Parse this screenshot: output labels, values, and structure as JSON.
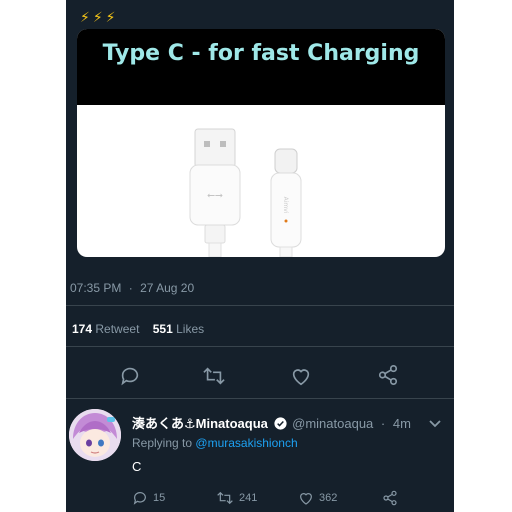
{
  "top_emojis": "⚡⚡⚡",
  "media": {
    "title": "Type C - for fast Charging",
    "cable_brand_text": "Aimvi"
  },
  "tweet": {
    "time": "07:35 PM",
    "separator": "·",
    "date": "27 Aug 20",
    "retweet_count": "174",
    "retweet_label": "Retweet",
    "likes_count": "551",
    "likes_label": "Likes"
  },
  "reply": {
    "display_name": "湊あくあ⚓Minatoaqua",
    "handle": "@minatoaqua",
    "separator": "·",
    "time": "4m",
    "replying_prefix": "Replying to",
    "replying_handle": "@murasakishionch",
    "text": "C",
    "reply_count": "15",
    "retweet_count": "241",
    "like_count": "362"
  },
  "icons": [
    "reply-icon",
    "retweet-icon",
    "like-icon",
    "share-icon",
    "verified-icon",
    "chevron-down-icon"
  ],
  "colors": {
    "background": "#15202b",
    "text": "#ffffff",
    "secondary": "#8899a6",
    "link": "#1da1f2",
    "title": "#9fe8e8"
  }
}
